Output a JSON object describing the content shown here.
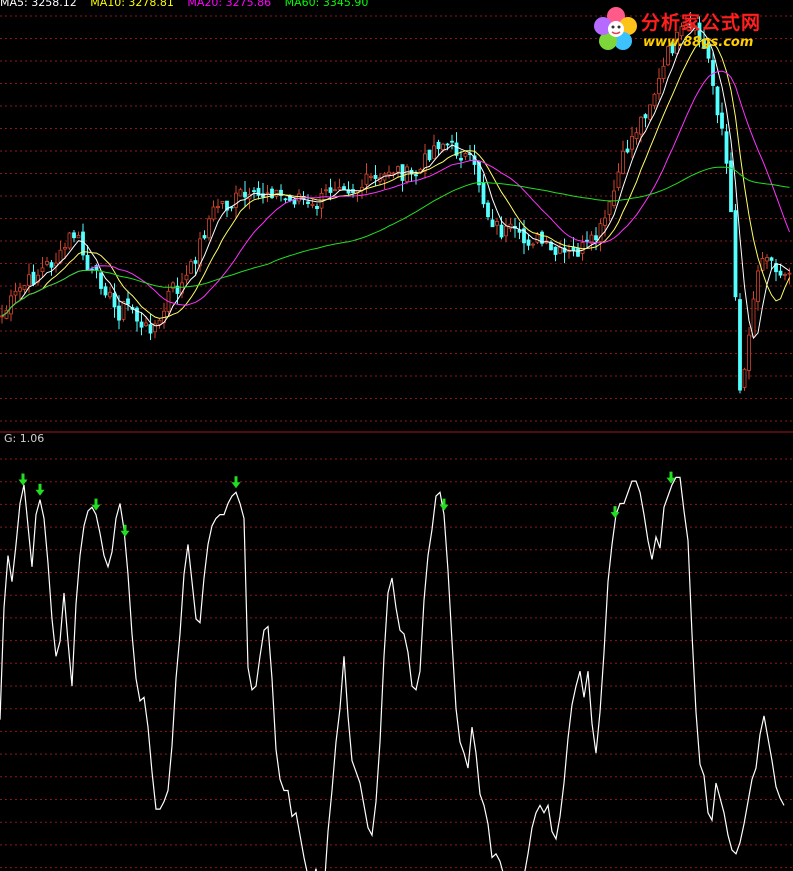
{
  "header": {
    "ma_labels": [
      {
        "text": "MA5: 3258.12",
        "color": "#ffffff"
      },
      {
        "text": "MA10: 3278.81",
        "color": "#ffff00"
      },
      {
        "text": "MA20: 3275.86",
        "color": "#ff00ff"
      },
      {
        "text": "MA60: 3345.90",
        "color": "#00ff00"
      }
    ]
  },
  "logo": {
    "name": "分析家公式网",
    "url": "www.88gs.com",
    "colors": {
      "name": "#ff1f1f",
      "url": "#ffd000"
    }
  },
  "indicator": {
    "label": "G: 1.06"
  },
  "colors": {
    "background": "#000000",
    "grid": "#8a1a1a",
    "divider": "#a01818",
    "candle_up": "#d2452c",
    "candle_down": "#54ffff",
    "ma5": "#ffffff",
    "ma10": "#ffff66",
    "ma20": "#ff33ff",
    "ma60": "#22dd22",
    "indicator_line": "#ffffff",
    "signal_arrow": "#22dd22"
  },
  "chart_data": [
    {
      "type": "candlestick",
      "title": "",
      "y_anchor_points": [
        [
          0,
          8.1
        ],
        [
          10,
          7.3
        ],
        [
          20,
          6.5
        ],
        [
          30,
          6.1
        ],
        [
          40,
          5.6
        ],
        [
          48,
          5.2
        ],
        [
          60,
          4.9
        ],
        [
          72,
          3.5
        ],
        [
          80,
          4.1
        ],
        [
          88,
          5.6
        ],
        [
          96,
          5.9
        ],
        [
          104,
          6.2
        ],
        [
          112,
          7.3
        ],
        [
          118,
          7.8
        ],
        [
          126,
          7.3
        ],
        [
          134,
          7.6
        ],
        [
          142,
          8.8
        ],
        [
          150,
          8.4
        ],
        [
          160,
          8.4
        ],
        [
          170,
          6.5
        ],
        [
          180,
          6.5
        ],
        [
          190,
          5.6
        ],
        [
          200,
          4.1
        ],
        [
          210,
          2.7
        ],
        [
          220,
          1.9
        ],
        [
          230,
          2.2
        ],
        [
          240,
          1.5
        ],
        [
          250,
          1.9
        ],
        [
          260,
          1.6
        ],
        [
          270,
          1.2
        ],
        [
          280,
          1.6
        ],
        [
          290,
          1.9
        ],
        [
          300,
          1.5
        ],
        [
          310,
          2.4
        ],
        [
          320,
          1.9
        ],
        [
          330,
          1.2
        ],
        [
          340,
          0.7
        ],
        [
          350,
          1.2
        ],
        [
          360,
          1.2
        ],
        [
          370,
          0.7
        ],
        [
          380,
          0.9
        ],
        [
          390,
          0.1
        ],
        [
          400,
          0.3
        ],
        [
          410,
          0.6
        ],
        [
          420,
          0.3
        ],
        [
          430,
          -0.8
        ],
        [
          440,
          -1.3
        ],
        [
          450,
          -1.0
        ],
        [
          460,
          -0.7
        ],
        [
          470,
          -0.2
        ],
        [
          478,
          0.6
        ],
        [
          486,
          2.4
        ],
        [
          494,
          3.0
        ],
        [
          502,
          3.5
        ],
        [
          512,
          3.5
        ],
        [
          522,
          4.1
        ],
        [
          532,
          3.8
        ],
        [
          542,
          4.1
        ],
        [
          552,
          4.7
        ],
        [
          562,
          4.7
        ],
        [
          572,
          4.7
        ],
        [
          582,
          4.4
        ],
        [
          592,
          4.1
        ],
        [
          600,
          3.5
        ],
        [
          610,
          2.2
        ],
        [
          620,
          0.1
        ],
        [
          630,
          -1.3
        ],
        [
          640,
          -2.3
        ],
        [
          650,
          -3.4
        ],
        [
          660,
          -4.5
        ],
        [
          668,
          -5.9
        ],
        [
          676,
          -6.6
        ],
        [
          684,
          -7.1
        ],
        [
          692,
          -7.1
        ],
        [
          700,
          -6.7
        ],
        [
          708,
          -5.7
        ],
        [
          716,
          -3.4
        ],
        [
          722,
          -2.0
        ],
        [
          728,
          0.6
        ],
        [
          732,
          3.5
        ],
        [
          736,
          7.0
        ],
        [
          740,
          11.7
        ],
        [
          744,
          11.0
        ],
        [
          748,
          9.0
        ],
        [
          752,
          7.3
        ],
        [
          758,
          5.6
        ],
        [
          764,
          4.1
        ],
        [
          770,
          4.9
        ],
        [
          776,
          5.6
        ],
        [
          782,
          5.6
        ],
        [
          792,
          5.2
        ]
      ],
      "y_scale_note": "",
      "ma_series": [
        {
          "name": "MA5",
          "values": "computed"
        },
        {
          "name": "MA10",
          "values": "computed"
        },
        {
          "name": "MA20",
          "values": "computed"
        },
        {
          "name": "MA60",
          "values": "computed"
        }
      ]
    },
    {
      "type": "line",
      "title": "",
      "series_name": "G",
      "ylim": [
        0.0,
        1.1
      ],
      "x": [
        0,
        4,
        8,
        12,
        16,
        20,
        24,
        28,
        32,
        36,
        40,
        44,
        48,
        52,
        56,
        60,
        64,
        68,
        72,
        76,
        80,
        84,
        88,
        92,
        96,
        100,
        104,
        108,
        112,
        116,
        120,
        124,
        128,
        132,
        136,
        140,
        144,
        148,
        152,
        156,
        160,
        164,
        168,
        172,
        176,
        180,
        184,
        188,
        192,
        196,
        200,
        204,
        208,
        212,
        216,
        220,
        224,
        228,
        232,
        236,
        240,
        244,
        248,
        252,
        256,
        260,
        264,
        268,
        272,
        276,
        280,
        284,
        288,
        292,
        296,
        300,
        304,
        308,
        312,
        316,
        320,
        324,
        328,
        332,
        336,
        340,
        344,
        348,
        352,
        356,
        360,
        364,
        368,
        372,
        376,
        380,
        384,
        388,
        392,
        396,
        400,
        404,
        408,
        412,
        416,
        420,
        424,
        428,
        432,
        436,
        440,
        444,
        448,
        452,
        456,
        460,
        464,
        468,
        472,
        476,
        480,
        484,
        488,
        492,
        496,
        500,
        504,
        508,
        512,
        516,
        520,
        524,
        528,
        532,
        536,
        540,
        544,
        548,
        552,
        556,
        560,
        564,
        568,
        572,
        576,
        580,
        584,
        588,
        592,
        596,
        600,
        604,
        608,
        612,
        616,
        620,
        624,
        628,
        632,
        636,
        640,
        644,
        648,
        652,
        656,
        660,
        664,
        668,
        672,
        676,
        680,
        684,
        688,
        692,
        696,
        700,
        704,
        708,
        712,
        716,
        720,
        724,
        728,
        732,
        736,
        740,
        744,
        748,
        752,
        756,
        760,
        764,
        768,
        772,
        776,
        780,
        784,
        788,
        792
      ],
      "values": [
        0.39,
        0.69,
        0.83,
        0.76,
        0.86,
        0.97,
        1.02,
        0.91,
        0.8,
        0.94,
        0.98,
        0.93,
        0.81,
        0.66,
        0.56,
        0.6,
        0.73,
        0.6,
        0.48,
        0.7,
        0.83,
        0.91,
        0.95,
        0.96,
        0.94,
        0.89,
        0.83,
        0.8,
        0.84,
        0.93,
        0.97,
        0.9,
        0.78,
        0.62,
        0.5,
        0.44,
        0.45,
        0.37,
        0.25,
        0.15,
        0.15,
        0.17,
        0.2,
        0.32,
        0.5,
        0.62,
        0.78,
        0.86,
        0.76,
        0.66,
        0.65,
        0.77,
        0.86,
        0.91,
        0.93,
        0.94,
        0.94,
        0.97,
        0.99,
        1.0,
        0.97,
        0.93,
        0.53,
        0.47,
        0.48,
        0.56,
        0.63,
        0.64,
        0.5,
        0.31,
        0.23,
        0.2,
        0.2,
        0.13,
        0.14,
        0.08,
        0.02,
        -0.03,
        -0.05,
        -0.01,
        -0.08,
        -0.07,
        0.09,
        0.2,
        0.33,
        0.42,
        0.56,
        0.4,
        0.28,
        0.25,
        0.22,
        0.16,
        0.1,
        0.08,
        0.17,
        0.33,
        0.56,
        0.73,
        0.77,
        0.69,
        0.63,
        0.62,
        0.57,
        0.48,
        0.47,
        0.52,
        0.71,
        0.83,
        0.9,
        0.99,
        1.0,
        0.94,
        0.79,
        0.6,
        0.42,
        0.33,
        0.3,
        0.26,
        0.37,
        0.3,
        0.19,
        0.16,
        0.11,
        0.02,
        0.03,
        0.01,
        -0.03,
        -0.06,
        -0.08,
        -0.05,
        -0.06,
        -0.03,
        0.03,
        0.1,
        0.14,
        0.16,
        0.14,
        0.16,
        0.09,
        0.07,
        0.13,
        0.22,
        0.34,
        0.43,
        0.48,
        0.52,
        0.45,
        0.52,
        0.38,
        0.3,
        0.41,
        0.57,
        0.76,
        0.86,
        0.94,
        0.97,
        0.97,
        1.0,
        1.03,
        1.03,
        1.0,
        0.94,
        0.87,
        0.82,
        0.88,
        0.85,
        0.96,
        0.99,
        1.02,
        1.04,
        1.04,
        0.95,
        0.87,
        0.62,
        0.41,
        0.27,
        0.24,
        0.14,
        0.12,
        0.22,
        0.18,
        0.14,
        0.08,
        0.04,
        0.03,
        0.06,
        0.11,
        0.17,
        0.23,
        0.26,
        0.35,
        0.4,
        0.34,
        0.28,
        0.21,
        0.18,
        0.16
      ],
      "signal_arrows_at_x": [
        23,
        40,
        96,
        125,
        236,
        444,
        615,
        671
      ]
    }
  ]
}
